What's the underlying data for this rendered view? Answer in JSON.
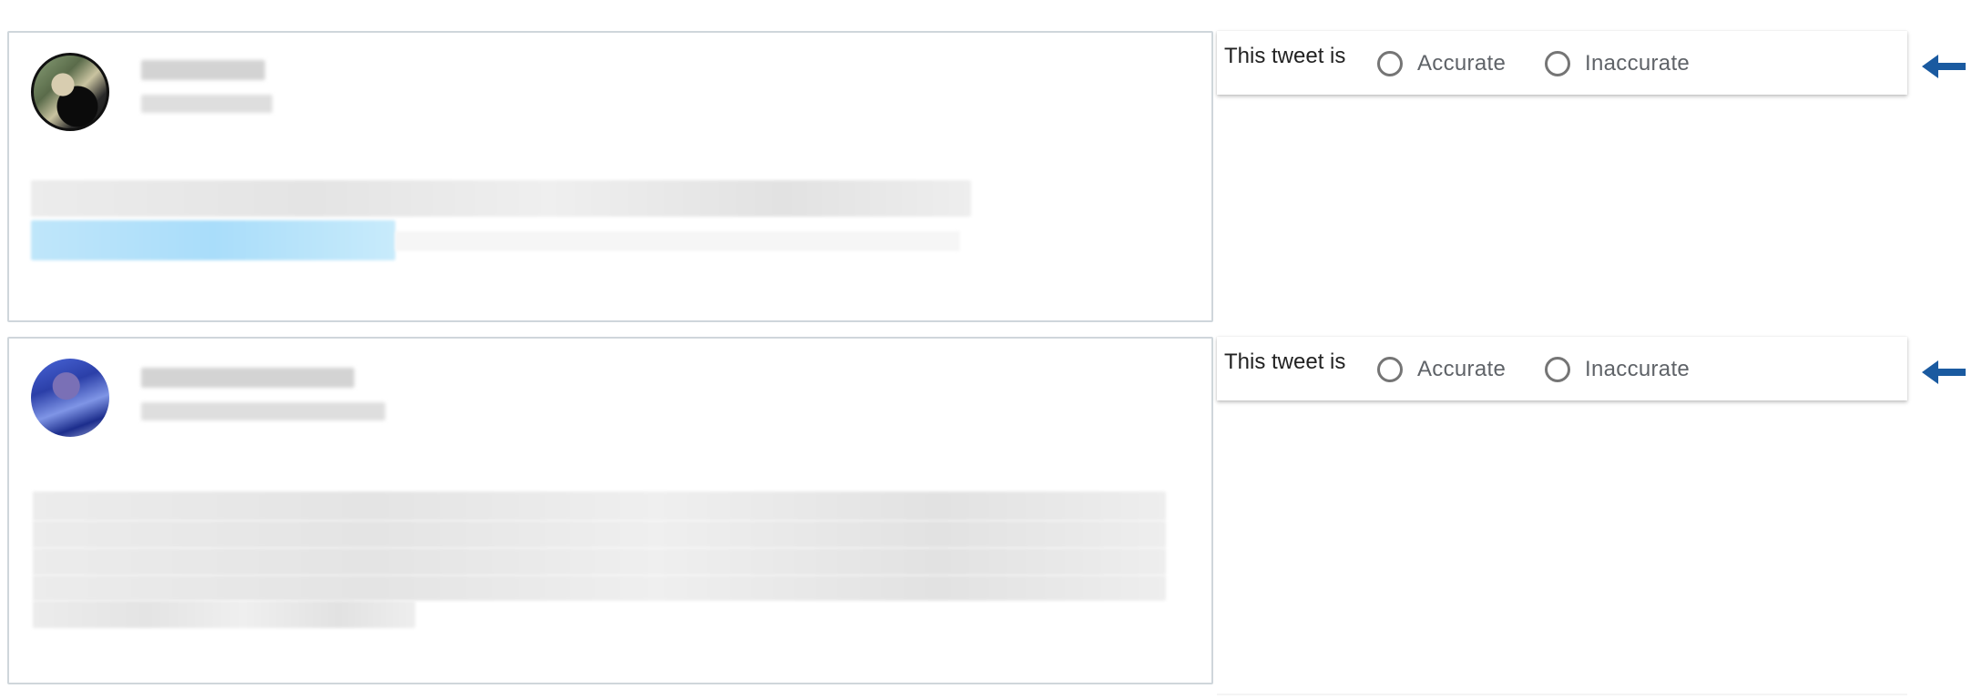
{
  "tweets": [
    {
      "prompt": "This tweet is",
      "options": [
        "Accurate",
        "Inaccurate"
      ]
    },
    {
      "prompt": "This tweet is",
      "options": [
        "Accurate",
        "Inaccurate"
      ]
    }
  ],
  "colors": {
    "arrow": "#1a5aa0",
    "card_border": "#cfd6db",
    "radio_border": "#757575",
    "option_text": "#5f6368"
  },
  "icons": {
    "row_indicator": "left-arrow-icon"
  }
}
